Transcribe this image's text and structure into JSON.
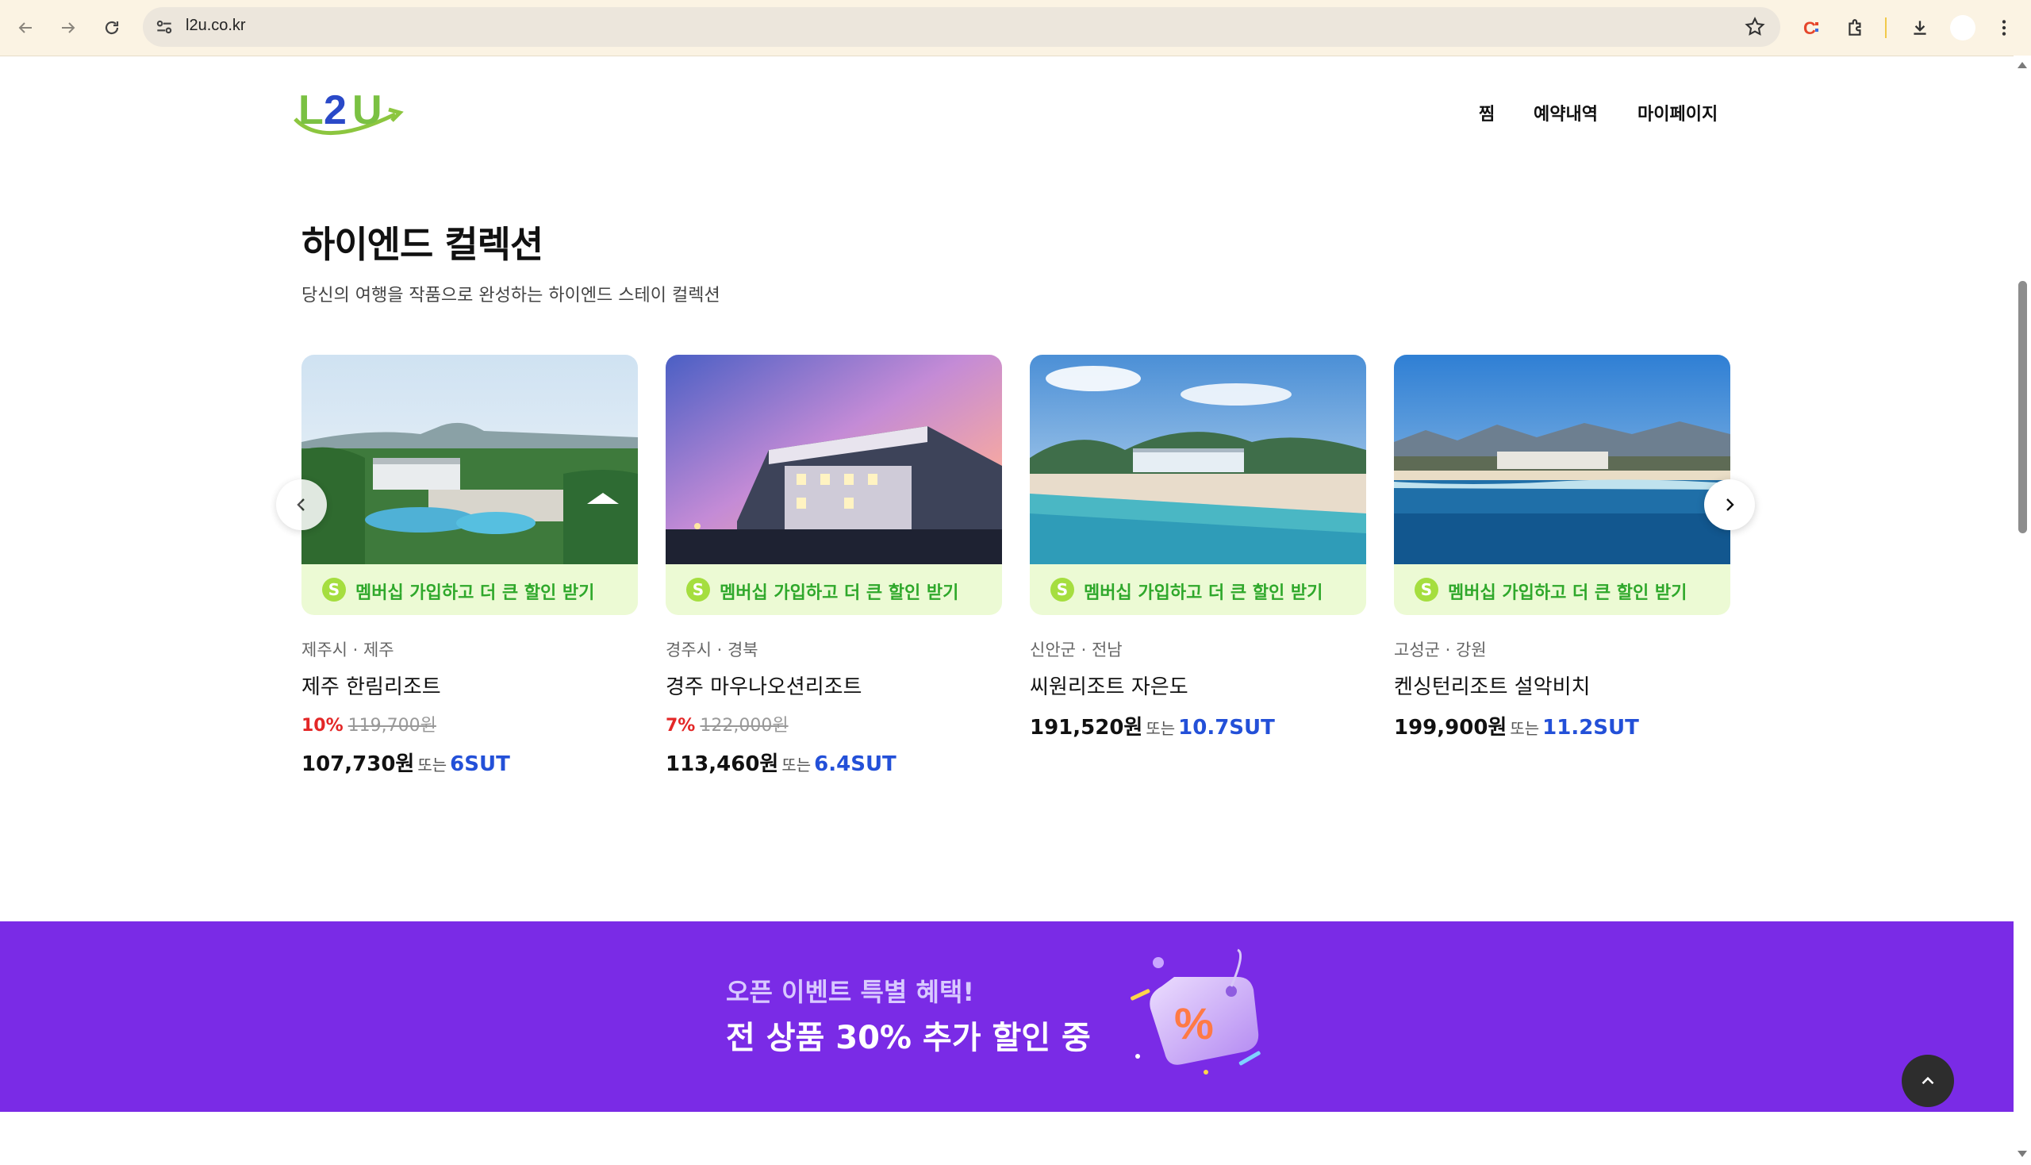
{
  "browser": {
    "url": "l2u.co.kr"
  },
  "header": {
    "logo_text": "L2U",
    "nav": [
      "찜",
      "예약내역",
      "마이페이지"
    ]
  },
  "section": {
    "title": "하이엔드 컬렉션",
    "subtitle": "당신의 여행을 작품으로 완성하는 하이엔드 스테이 컬렉션"
  },
  "cards": [
    {
      "badge_letter": "S",
      "promo": "멤버십 가입하고 더 큰 할인 받기",
      "region": "제주시 · 제주",
      "name": "제주 한림리조트",
      "discount": "10%",
      "original_price": "119,700원",
      "price": "107,730원",
      "or": "또는",
      "sut": "6SUT"
    },
    {
      "badge_letter": "S",
      "promo": "멤버십 가입하고 더 큰 할인 받기",
      "region": "경주시 · 경북",
      "name": "경주 마우나오션리조트",
      "discount": "7%",
      "original_price": "122,000원",
      "price": "113,460원",
      "or": "또는",
      "sut": "6.4SUT"
    },
    {
      "badge_letter": "S",
      "promo": "멤버십 가입하고 더 큰 할인 받기",
      "region": "신안군 · 전남",
      "name": "씨원리조트 자은도",
      "price": "191,520원",
      "or": "또는",
      "sut": "10.7SUT"
    },
    {
      "badge_letter": "S",
      "promo": "멤버십 가입하고 더 큰 할인 받기",
      "region": "고성군 · 강원",
      "name": "켄싱턴리조트 설악비치",
      "price": "199,900원",
      "or": "또는",
      "sut": "11.2SUT"
    }
  ],
  "banner": {
    "line1": "오픈 이벤트 특별 혜택!",
    "line2": "전 상품 30% 추가 할인 중",
    "art_symbol": "%"
  },
  "colors": {
    "banner_bg": "#7a2be6",
    "promo_bg": "#ecfad4",
    "promo_text": "#2fa82b",
    "discount": "#e32727",
    "sut": "#2350d8"
  },
  "icons": [
    "back-icon",
    "forward-icon",
    "reload-icon",
    "site-settings-icon",
    "bookmark-star-icon",
    "extension-c-icon",
    "extensions-puzzle-icon",
    "download-icon",
    "menu-dots-icon",
    "chevron-left-icon",
    "chevron-right-icon",
    "chevron-up-icon"
  ]
}
